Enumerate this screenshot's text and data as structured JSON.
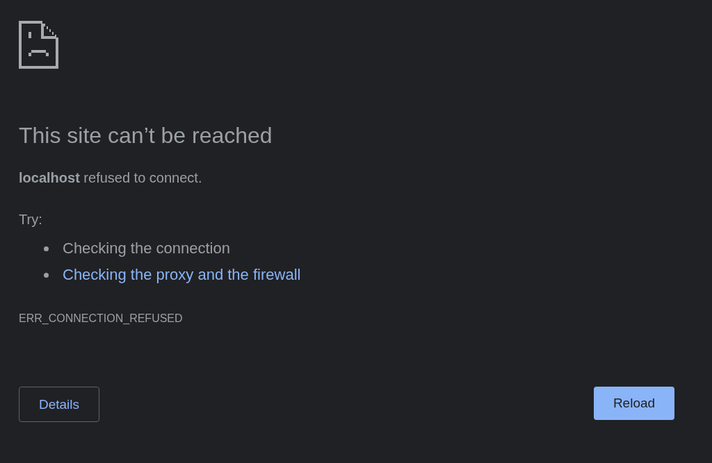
{
  "heading": "This site can’t be reached",
  "description": "**localhost** refused to connect.",
  "try_label": "Try:",
  "suggestions": [
    {
      "kind": "text",
      "text": "Checking the connection"
    },
    {
      "kind": "link",
      "text": "Checking the proxy and the firewall"
    }
  ],
  "error_code": "ERR_CONNECTION_REFUSED",
  "buttons": {
    "details": "Details",
    "reload": "Reload"
  }
}
